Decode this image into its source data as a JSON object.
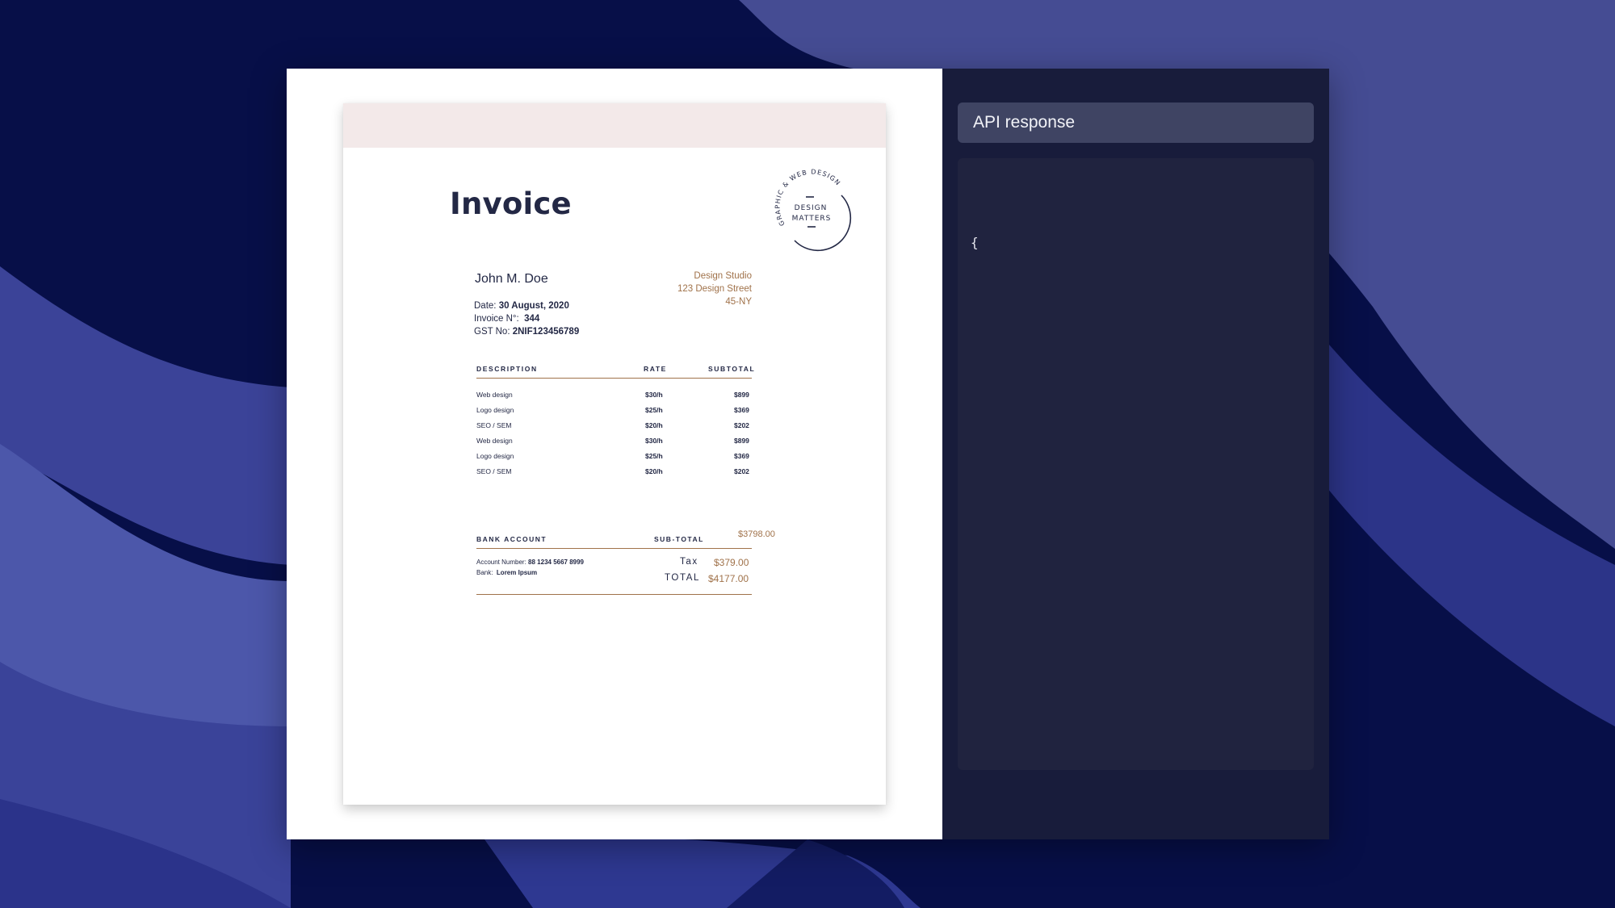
{
  "invoice": {
    "title": "Invoice",
    "logo": {
      "ring_text": "GRAPHIC & WEB DESIGN",
      "line1": "DESIGN",
      "line2": "MATTERS"
    },
    "client_name": "John M. Doe",
    "date_label": "Date:",
    "date_value": "30 August, 2020",
    "invoice_no_label": "Invoice N°:",
    "invoice_no_value": "344",
    "gst_label": "GST No:",
    "gst_value": "2NIF123456789",
    "studio": [
      "Design Studio",
      "123 Design Street",
      "45-NY"
    ],
    "columns": {
      "description": "DESCRIPTION",
      "rate": "RATE",
      "subtotal": "SUBTOTAL"
    },
    "items": [
      {
        "description": "Web design",
        "rate": "$30/h",
        "subtotal": "$899"
      },
      {
        "description": "Logo design",
        "rate": "$25/h",
        "subtotal": "$369"
      },
      {
        "description": "SEO / SEM",
        "rate": "$20/h",
        "subtotal": "$202"
      },
      {
        "description": "Web design",
        "rate": "$30/h",
        "subtotal": "$899"
      },
      {
        "description": "Logo design",
        "rate": "$25/h",
        "subtotal": "$369"
      },
      {
        "description": "SEO / SEM",
        "rate": "$20/h",
        "subtotal": "$202"
      }
    ],
    "bank_account_label": "BANK ACCOUNT",
    "subtotal_label": "SUB-TOTAL",
    "subtotal_value": "$3798.00",
    "account_number_label": "Account Number:",
    "account_number_value": "88 1234 5667 8999",
    "bank_label": "Bank:",
    "bank_value": "Lorem Ipsum",
    "tax_label": "Tax",
    "tax_value": "$379.00",
    "total_label": "TOTAL",
    "total_value": "$4177.00"
  },
  "api": {
    "title": "API response",
    "body": "{"
  },
  "colors": {
    "background": "#070f48",
    "api_panel": "#181c3b",
    "accent": "#a0724a",
    "ink": "#232845"
  }
}
